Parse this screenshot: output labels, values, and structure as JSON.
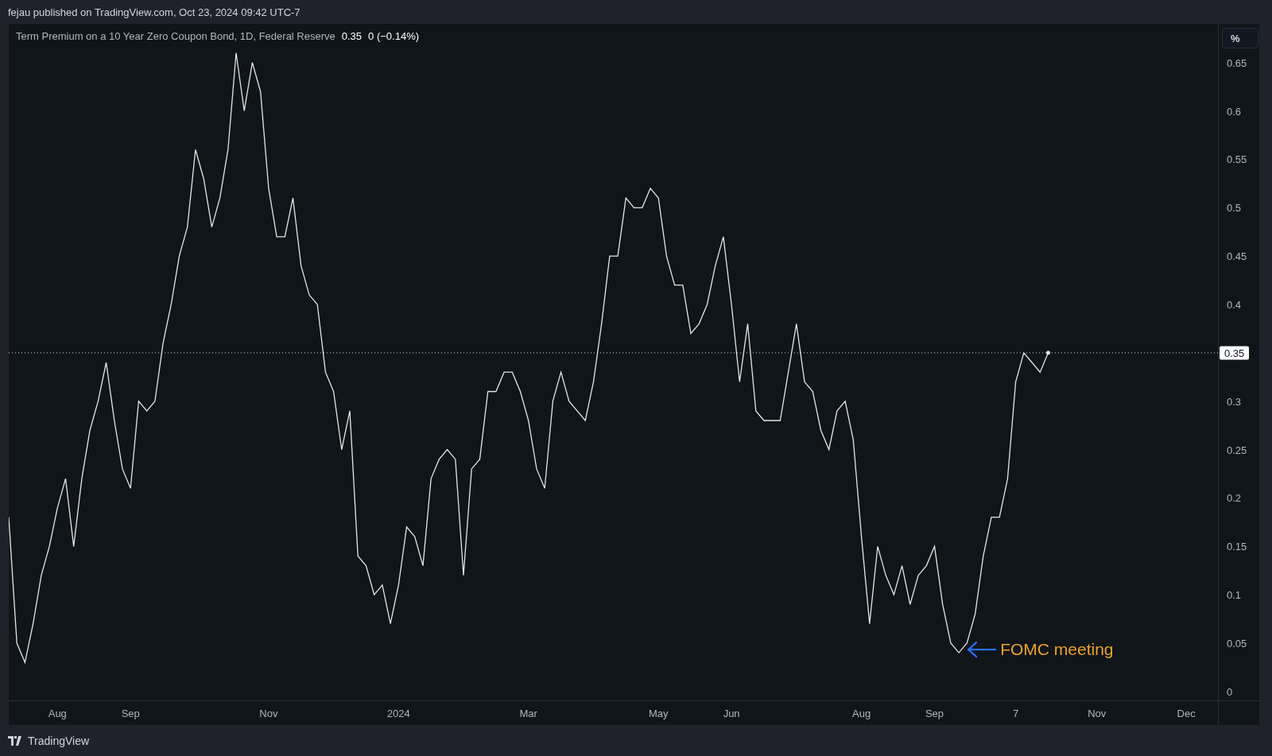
{
  "header": {
    "text": "fejau published on TradingView.com, Oct 23, 2024 09:42 UTC-7"
  },
  "legend": {
    "value": "0.35",
    "change": "0 (−0.14%)"
  },
  "price_scale": {
    "unit_button": "%",
    "last_value_label": "0.35"
  },
  "chart_data": {
    "type": "line",
    "categories": [
      null,
      null,
      null,
      null,
      null,
      null,
      "Aug",
      null,
      null,
      null,
      null,
      null,
      null,
      null,
      null,
      "Sep",
      null,
      null,
      null,
      null,
      null,
      null,
      null,
      null,
      null,
      null,
      null,
      null,
      null,
      null,
      null,
      null,
      "Nov",
      null,
      null,
      null,
      null,
      null,
      null,
      null,
      null,
      null,
      null,
      null,
      null,
      null,
      null,
      null,
      "2024",
      null,
      null,
      null,
      null,
      null,
      null,
      null,
      null,
      null,
      null,
      null,
      null,
      null,
      null,
      null,
      "Mar",
      null,
      null,
      null,
      null,
      null,
      null,
      null,
      null,
      null,
      null,
      null,
      null,
      null,
      null,
      null,
      "May",
      null,
      null,
      null,
      null,
      null,
      null,
      null,
      null,
      "Jun",
      null,
      null,
      null,
      null,
      null,
      null,
      null,
      null,
      null,
      null,
      null,
      null,
      null,
      null,
      null,
      "Aug",
      null,
      null,
      null,
      null,
      null,
      null,
      null,
      null,
      "Sep",
      null,
      null,
      null,
      null,
      null,
      null,
      null,
      null,
      null,
      "7",
      null,
      null,
      null,
      null,
      null,
      null,
      null,
      null,
      null,
      "Nov",
      null,
      null,
      null,
      null,
      null,
      null,
      null,
      null,
      null,
      null,
      "Dec",
      null,
      null,
      null,
      null
    ],
    "series": [
      {
        "name": "Term Premium on a 10 Year Zero Coupon Bond, 1D, Federal Reserve",
        "color": "#e6e6e6",
        "values": [
          0.18,
          0.05,
          0.03,
          0.07,
          0.12,
          0.15,
          0.19,
          0.22,
          0.15,
          0.22,
          0.27,
          0.3,
          0.34,
          0.28,
          0.23,
          0.21,
          0.3,
          0.29,
          0.3,
          0.36,
          0.4,
          0.45,
          0.48,
          0.56,
          0.53,
          0.48,
          0.51,
          0.56,
          0.66,
          0.6,
          0.65,
          0.62,
          0.52,
          0.47,
          0.47,
          0.51,
          0.44,
          0.41,
          0.4,
          0.33,
          0.31,
          0.25,
          0.29,
          0.14,
          0.13,
          0.1,
          0.11,
          0.07,
          0.11,
          0.17,
          0.16,
          0.13,
          0.22,
          0.24,
          0.25,
          0.24,
          0.12,
          0.23,
          0.24,
          0.31,
          0.31,
          0.33,
          0.33,
          0.31,
          0.28,
          0.23,
          0.21,
          0.3,
          0.33,
          0.3,
          0.29,
          0.28,
          0.32,
          0.38,
          0.45,
          0.45,
          0.51,
          0.5,
          0.5,
          0.52,
          0.51,
          0.45,
          0.42,
          0.42,
          0.37,
          0.38,
          0.4,
          0.44,
          0.47,
          0.4,
          0.32,
          0.38,
          0.29,
          0.28,
          0.28,
          0.28,
          0.33,
          0.38,
          0.32,
          0.31,
          0.27,
          0.25,
          0.29,
          0.3,
          0.26,
          0.16,
          0.07,
          0.15,
          0.12,
          0.1,
          0.13,
          0.09,
          0.12,
          0.13,
          0.15,
          0.09,
          0.05,
          0.04,
          0.05,
          0.08,
          0.14,
          0.18,
          0.18,
          0.22,
          0.32,
          0.35,
          0.34,
          0.33,
          0.35,
          null,
          null,
          null,
          null,
          null,
          null,
          null,
          null,
          null,
          null,
          null,
          null,
          null,
          null,
          null,
          null,
          null,
          null,
          null,
          null,
          null
        ]
      }
    ],
    "ylim": [
      -0.01,
      0.69
    ],
    "yticks": [
      {
        "value": 0,
        "label": "0"
      },
      {
        "value": 0.05,
        "label": "0.05"
      },
      {
        "value": 0.1,
        "label": "0.1"
      },
      {
        "value": 0.15,
        "label": "0.15"
      },
      {
        "value": 0.2,
        "label": "0.2"
      },
      {
        "value": 0.25,
        "label": "0.25"
      },
      {
        "value": 0.3,
        "label": "0.3"
      },
      {
        "value": 0.4,
        "label": "0.4"
      },
      {
        "value": 0.45,
        "label": "0.45"
      },
      {
        "value": 0.5,
        "label": "0.5"
      },
      {
        "value": 0.55,
        "label": "0.55"
      },
      {
        "value": 0.6,
        "label": "0.6"
      },
      {
        "value": 0.65,
        "label": "0.65"
      }
    ],
    "ref_lines": [
      {
        "axis": "y",
        "value": 0.35
      }
    ],
    "annotations": [
      "FOMC meeting"
    ]
  },
  "footer": {
    "brand": "TradingView"
  }
}
